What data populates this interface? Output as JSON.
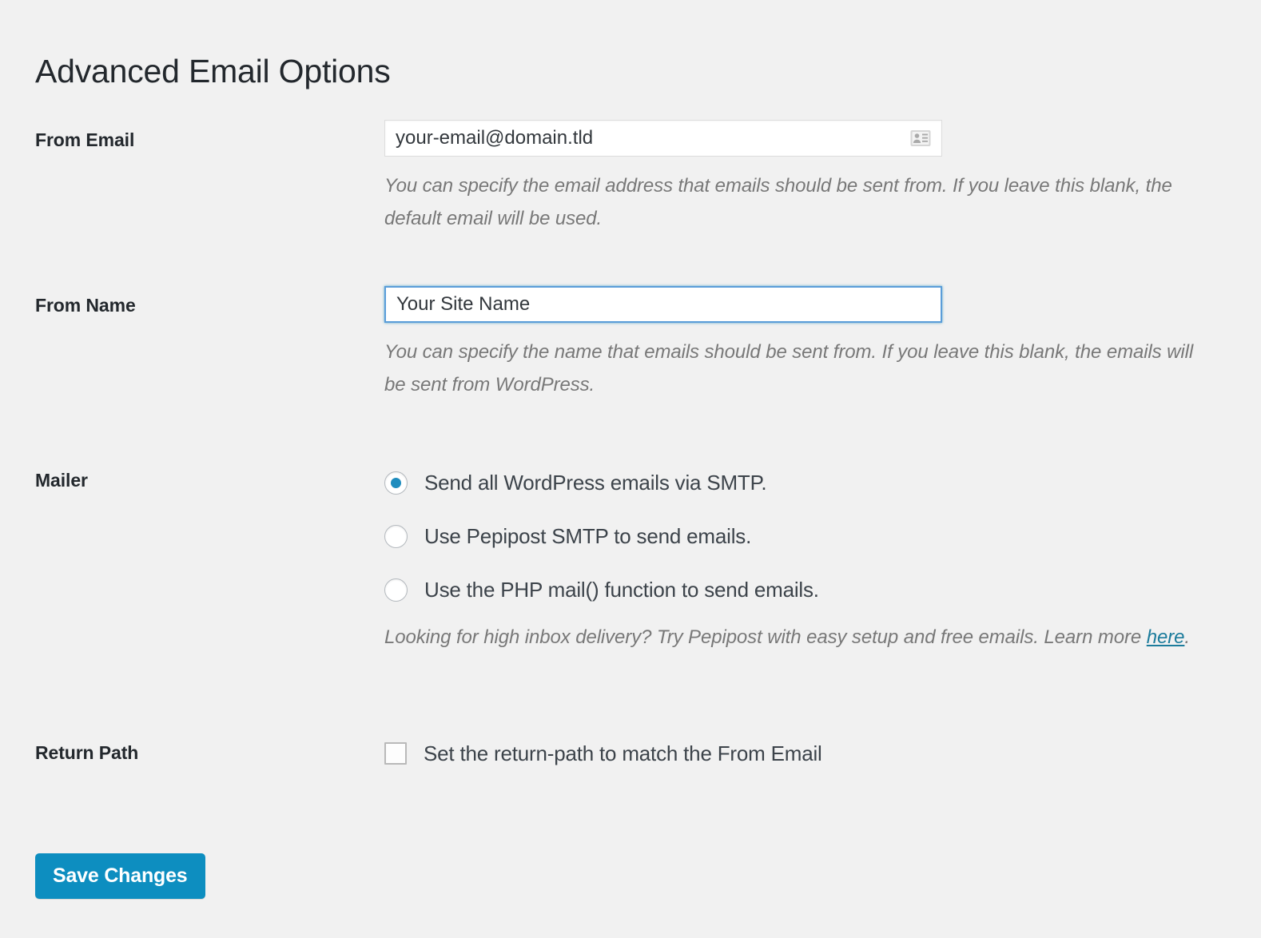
{
  "page": {
    "title": "Advanced Email Options",
    "background_color": "#f1f1f1",
    "accent_color": "#1e8cbe",
    "button_color": "#0d8ec0",
    "link_color": "#1c7c9c"
  },
  "fields": {
    "from_email": {
      "label": "From Email",
      "value": "your-email@domain.tld",
      "placeholder": "your-email@domain.tld",
      "icon": "contact-card-icon",
      "description": "You can specify the email address that emails should be sent from. If you leave this blank, the default email will be used."
    },
    "from_name": {
      "label": "From Name",
      "value": "Your Site Name",
      "placeholder": "Your Site Name",
      "focused": true,
      "description": "You can specify the name that emails should be sent from. If you leave this blank, the emails will be sent from WordPress."
    },
    "mailer": {
      "label": "Mailer",
      "options": [
        {
          "label": "Send all WordPress emails via SMTP.",
          "checked": true
        },
        {
          "label": "Use Pepipost SMTP to send emails.",
          "checked": false
        },
        {
          "label": "Use the PHP mail() function to send emails.",
          "checked": false
        }
      ],
      "description_before_link": "Looking for high inbox delivery? Try Pepipost with easy setup and free emails. Learn more ",
      "description_link": "here",
      "description_after_link": "."
    },
    "return_path": {
      "label": "Return Path",
      "checkbox_label": "Set the return-path to match the From Email",
      "checked": false
    }
  },
  "actions": {
    "save_label": "Save Changes"
  }
}
